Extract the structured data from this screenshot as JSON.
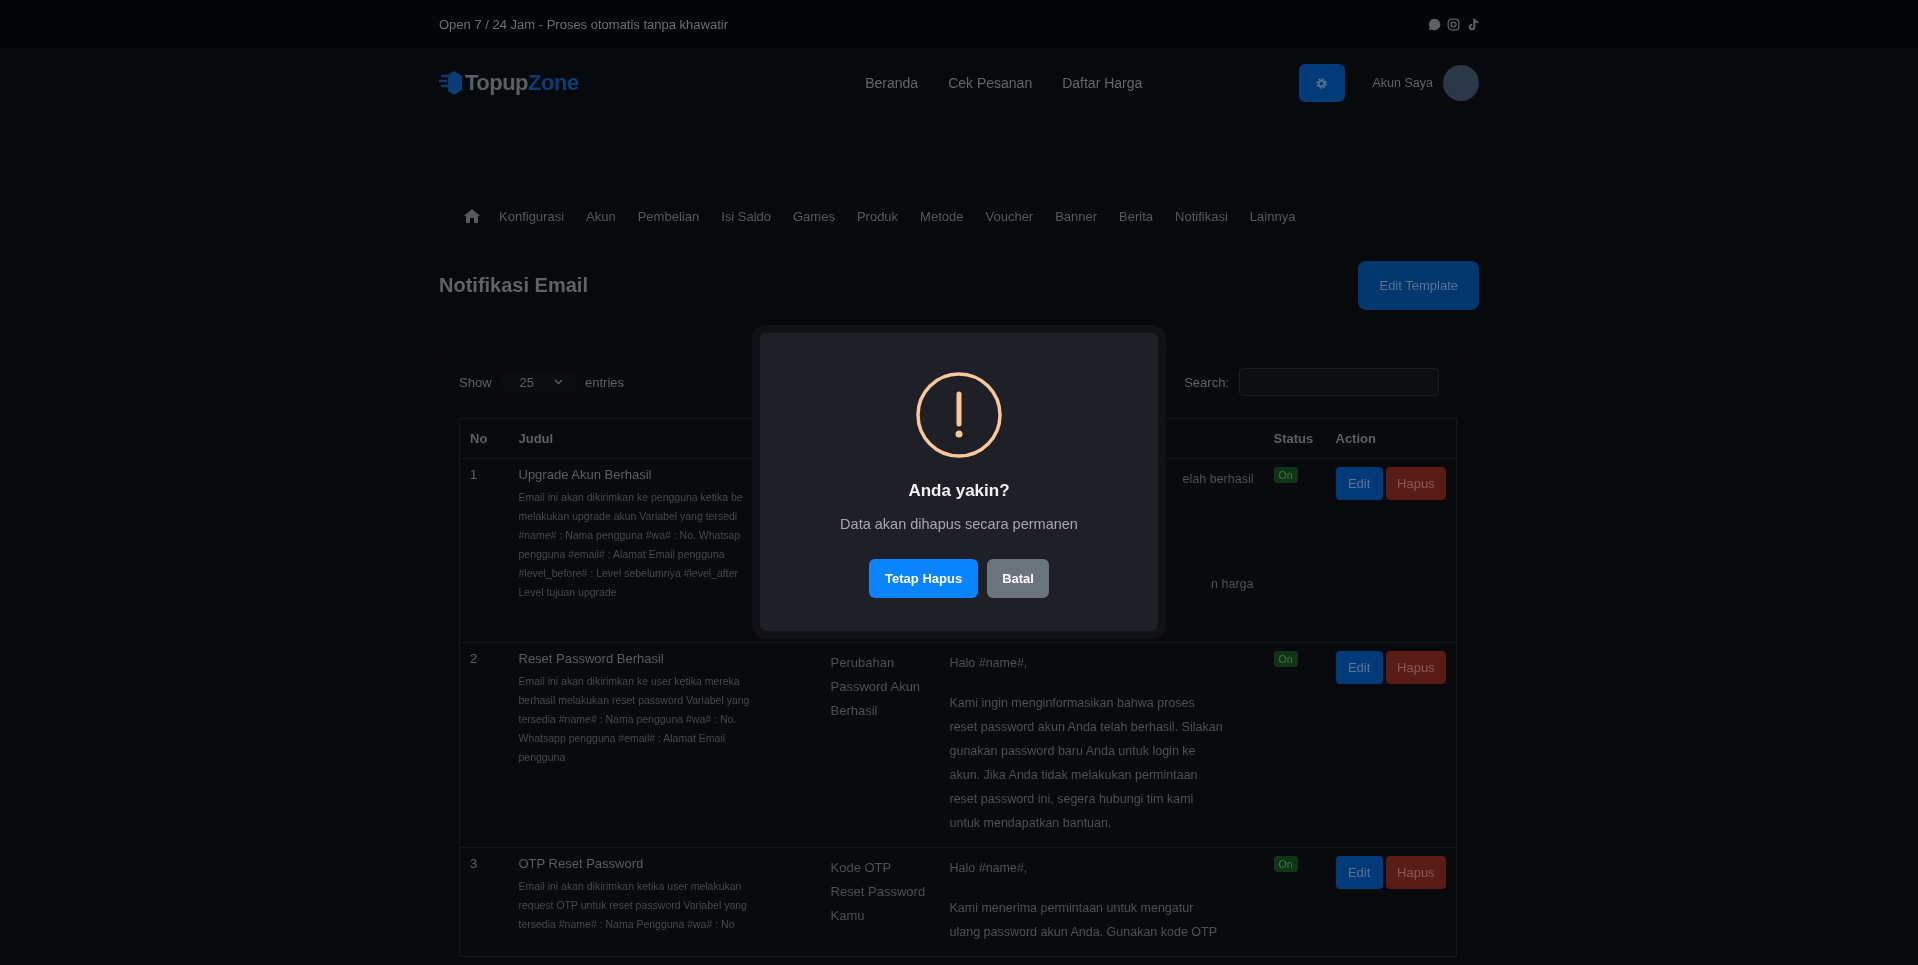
{
  "topbar": {
    "tagline": "Open 7 / 24 Jam - Proses otomatis tanpa khawatir"
  },
  "header": {
    "logo_parts": [
      "Topup",
      "Zone"
    ],
    "nav": [
      {
        "label": "Beranda"
      },
      {
        "label": "Cek Pesanan"
      },
      {
        "label": "Daftar Harga"
      }
    ],
    "account_label": "Akun Saya"
  },
  "menu": [
    {
      "label": "Konfigurasi"
    },
    {
      "label": "Akun"
    },
    {
      "label": "Pembelian"
    },
    {
      "label": "Isi Saldo"
    },
    {
      "label": "Games"
    },
    {
      "label": "Produk"
    },
    {
      "label": "Metode"
    },
    {
      "label": "Voucher"
    },
    {
      "label": "Banner"
    },
    {
      "label": "Berita"
    },
    {
      "label": "Notifikasi"
    },
    {
      "label": "Lainnya"
    }
  ],
  "page_title": "Notifikasi Email",
  "edit_template_button": "Edit Template",
  "table_controls": {
    "show_label": "Show",
    "page_size": "25",
    "entries_label": "entries",
    "search_label": "Search:"
  },
  "table": {
    "columns": [
      "No",
      "Judul",
      "",
      "",
      "Status",
      "Action"
    ],
    "rows": [
      {
        "no": "1",
        "title": "Upgrade Akun Berhasil",
        "description_lines": [
          "Email ini akan dikirimkan ke pengguna ketika be",
          "melakukan upgrade akun Variabel yang tersedi",
          "#name# : Nama pengguna #wa# : No. Whatsap",
          "pengguna #email# : Alamat Email pengguna",
          "#level_before# : Level sebelumnya #level_after",
          "Level tujuan upgrade"
        ],
        "covered": true,
        "content": [
          [
            "elah berhasil"
          ],
          [
            "n harga"
          ]
        ],
        "status": "On",
        "edit": "Edit",
        "delete": "Hapus"
      },
      {
        "no": "2",
        "title": "Reset Password Berhasil",
        "description_lines": [
          "Email ini akan dikirimkan ke user ketika mereka",
          "berhasil melakukan reset password Variabel yang",
          "tersedia #name# : Nama pengguna #wa# : No.",
          "Whatsapp pengguna #email# : Alamat Email",
          "pengguna"
        ],
        "subject_lines": [
          "Perubahan",
          "Password Akun",
          "Berhasil"
        ],
        "covered": false,
        "content": [
          [
            "Halo #name#,"
          ],
          [
            "Kami ingin menginformasikan bahwa proses",
            "reset password akun Anda telah berhasil. Silakan",
            "gunakan password baru Anda untuk login ke",
            "akun. Jika Anda tidak melakukan permintaan",
            "reset password ini, segera hubungi tim kami",
            "untuk mendapatkan bantuan."
          ]
        ],
        "status": "On",
        "edit": "Edit",
        "delete": "Hapus"
      },
      {
        "no": "3",
        "title": "OTP Reset Password",
        "description_lines": [
          "Email ini akan dikirimkan ketika user melakukan",
          "request OTP untuk reset password Variabel yang",
          "tersedia #name# : Nama Pengguna #wa# : No"
        ],
        "subject_lines": [
          "Kode OTP",
          "Reset Password",
          "Kamu"
        ],
        "covered": false,
        "content": [
          [
            "Halo #name#,"
          ],
          [
            "Kami menerima permintaan untuk mengatur",
            "ulang password akun Anda. Gunakan kode OTP"
          ]
        ],
        "status": "On",
        "edit": "Edit",
        "delete": "Hapus"
      }
    ]
  },
  "dialog": {
    "title": "Anda yakin?",
    "message": "Data akan dihapus secara permanen",
    "confirm_button": "Tetap Hapus",
    "cancel_button": "Batal"
  }
}
